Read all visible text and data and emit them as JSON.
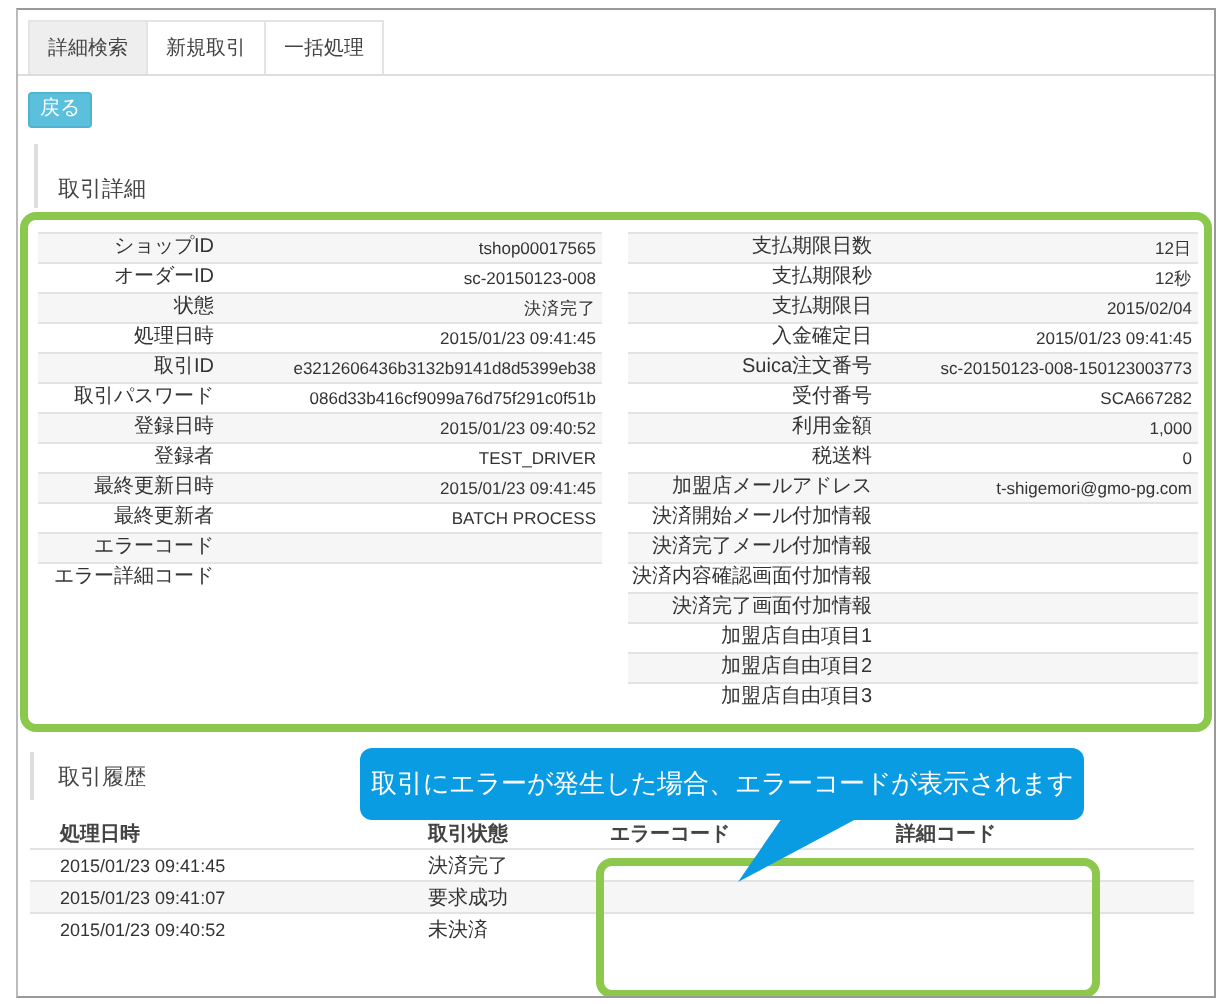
{
  "tabs": [
    {
      "label": "詳細検索",
      "selected": true
    },
    {
      "label": "新規取引",
      "selected": false
    },
    {
      "label": "一括処理",
      "selected": false
    }
  ],
  "back_button": "戻る",
  "detail": {
    "title": "取引詳細",
    "left": [
      {
        "label": "ショップID",
        "value": "tshop00017565"
      },
      {
        "label": "オーダーID",
        "value": "sc-20150123-008"
      },
      {
        "label": "状態",
        "value": "決済完了"
      },
      {
        "label": "処理日時",
        "value": "2015/01/23 09:41:45"
      },
      {
        "label": "取引ID",
        "value": "e3212606436b3132b9141d8d5399eb38"
      },
      {
        "label": "取引パスワード",
        "value": "086d33b416cf9099a76d75f291c0f51b"
      },
      {
        "label": "登録日時",
        "value": "2015/01/23 09:40:52"
      },
      {
        "label": "登録者",
        "value": "TEST_DRIVER"
      },
      {
        "label": "最終更新日時",
        "value": "2015/01/23 09:41:45"
      },
      {
        "label": "最終更新者",
        "value": "BATCH PROCESS"
      },
      {
        "label": "エラーコード"
      },
      {
        "label": "エラー詳細コード"
      }
    ],
    "right": [
      {
        "label": "支払期限日数",
        "value": "12日"
      },
      {
        "label": "支払期限秒",
        "value": "12秒"
      },
      {
        "label": "支払期限日",
        "value": "2015/02/04"
      },
      {
        "label": "入金確定日",
        "value": "2015/01/23 09:41:45"
      },
      {
        "label": "Suica注文番号",
        "value": "sc-20150123-008-150123003773"
      },
      {
        "label": "受付番号",
        "value": "SCA667282"
      },
      {
        "label": "利用金額",
        "value": "1,000"
      },
      {
        "label": "税送料",
        "value": "0"
      },
      {
        "label": "加盟店メールアドレス",
        "value": "t-shigemori@gmo-pg.com"
      },
      {
        "label": "決済開始メール付加情報"
      },
      {
        "label": "決済完了メール付加情報"
      },
      {
        "label": "決済内容確認画面付加情報"
      },
      {
        "label": "決済完了画面付加情報"
      },
      {
        "label": "加盟店自由項目1"
      },
      {
        "label": "加盟店自由項目2"
      },
      {
        "label": "加盟店自由項目3"
      }
    ]
  },
  "history": {
    "title": "取引履歴",
    "columns": [
      "処理日時",
      "取引状態",
      "エラーコード",
      "詳細コード"
    ],
    "rows": [
      [
        "2015/01/23 09:41:45",
        "決済完了"
      ],
      [
        "2015/01/23 09:41:07",
        "要求成功"
      ],
      [
        "2015/01/23 09:40:52",
        "未決済"
      ]
    ]
  },
  "callout": {
    "text": "取引にエラーが発生した場合、エラーコードが表示されます"
  }
}
